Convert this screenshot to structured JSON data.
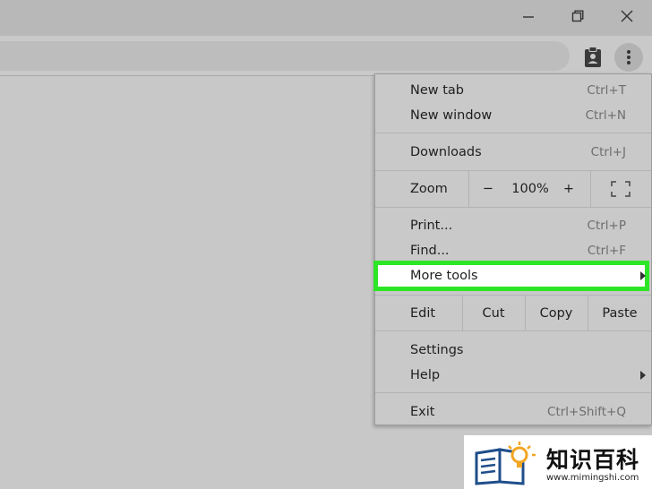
{
  "window": {
    "minimize_icon": "minimize-icon",
    "restore_icon": "restore-icon",
    "close_icon": "close-icon"
  },
  "toolbar": {
    "extension_icon": "clipboard-person-icon",
    "menu_icon": "kebab-menu-icon"
  },
  "menu": {
    "new_tab": {
      "label": "New tab",
      "shortcut": "Ctrl+T"
    },
    "new_window": {
      "label": "New window",
      "shortcut": "Ctrl+N"
    },
    "downloads": {
      "label": "Downloads",
      "shortcut": "Ctrl+J"
    },
    "zoom": {
      "label": "Zoom",
      "minus": "−",
      "level": "100%",
      "plus": "+"
    },
    "print": {
      "label": "Print...",
      "shortcut": "Ctrl+P"
    },
    "find": {
      "label": "Find...",
      "shortcut": "Ctrl+F"
    },
    "more_tools": {
      "label": "More tools"
    },
    "edit": {
      "label": "Edit",
      "cut": "Cut",
      "copy": "Copy",
      "paste": "Paste"
    },
    "settings": {
      "label": "Settings"
    },
    "help": {
      "label": "Help"
    },
    "exit": {
      "label": "Exit",
      "shortcut": "Ctrl+Shift+Q"
    },
    "highlight_color": "#2ce626"
  },
  "watermark": {
    "text": "知识百科",
    "url": "www.mimingshi.com"
  }
}
